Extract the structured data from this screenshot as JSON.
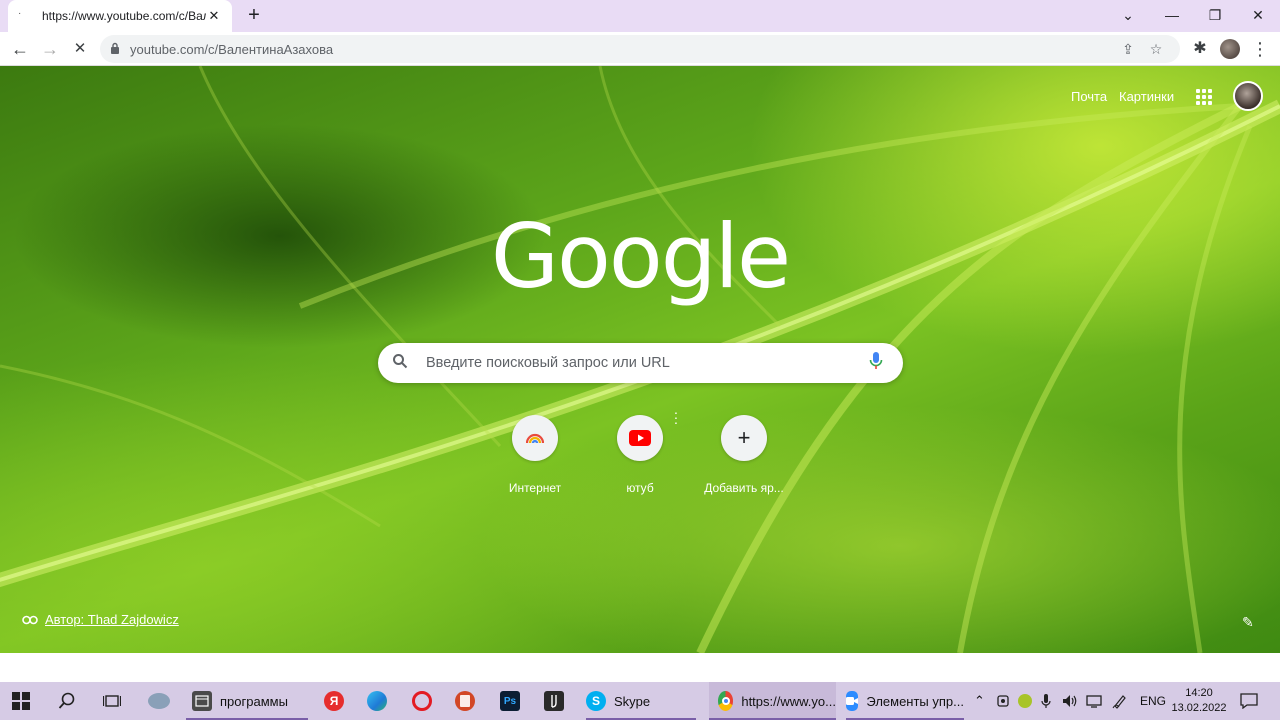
{
  "tab": {
    "title": "https://www.youtube.com/c/Вал",
    "close": "✕",
    "favicon": "·"
  },
  "new_tab": "+",
  "window_controls": {
    "dropdown": "⌄",
    "minimize": "—",
    "maximize": "❐",
    "close": "✕"
  },
  "toolbar": {
    "back": "←",
    "forward": "→",
    "reload": "✕",
    "url": "youtube.com/c/ВалентинаАзахова",
    "share": "⇪",
    "star": "☆",
    "extensions": "✱",
    "menu": "⋮"
  },
  "header": {
    "mail": "Почта",
    "images": "Картинки"
  },
  "logo": "Google",
  "search": {
    "placeholder": "Введите поисковый запрос или URL"
  },
  "shortcuts": [
    {
      "label": "Интернет",
      "icon": "rainbow-icon"
    },
    {
      "label": "ютуб",
      "icon": "youtube-icon"
    },
    {
      "label": "Добавить яр...",
      "icon": "plus-icon",
      "symbol": "+"
    }
  ],
  "shortcut_menu": "⋮",
  "attribution": {
    "text": "Автор: Thad Zajdowicz"
  },
  "edit": "✎",
  "taskbar": {
    "items": [
      {
        "label": "программы"
      },
      {
        "label": "Skype"
      },
      {
        "label": "https://www.yo..."
      },
      {
        "label": "Элементы упр..."
      }
    ],
    "yandex": "Я",
    "ps": "Ps",
    "skype_letter": "S",
    "lang": "ENG",
    "time": "14:20",
    "date": "13.02.2022"
  }
}
